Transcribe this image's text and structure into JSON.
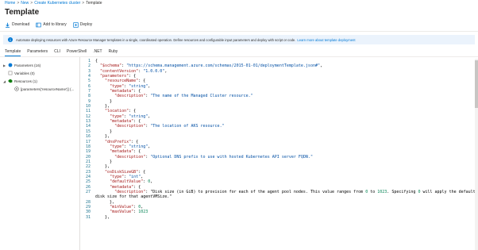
{
  "breadcrumb": {
    "items": [
      "Home",
      "New",
      "Create Kubernetes cluster"
    ],
    "current": "Template",
    "separator": ">"
  },
  "page": {
    "title": "Template"
  },
  "toolbar": {
    "download": "Download",
    "add_to_library": "Add to library",
    "deploy": "Deploy"
  },
  "info": {
    "text": "Automate deploying resources with Azure Resource Manager templates in a single, coordinated operation. Define resources and configurable input parameters and deploy with script or code.",
    "link": "Learn more about template deployment"
  },
  "tabs": [
    "Template",
    "Parameters",
    "CLI",
    "PowerShell",
    ".NET",
    "Ruby"
  ],
  "tree": [
    {
      "label": "Parameters (16)",
      "caret": "▶"
    },
    {
      "label": "Variables (0)",
      "caret": ""
    },
    {
      "label": "Resources (1)",
      "caret": "◢"
    },
    {
      "label": "[parameters('resourceName')] (...",
      "caret": ""
    }
  ],
  "code": [
    "{",
    "  \"$schema\": \"https://schema.management.azure.com/schemas/2015-01-01/deploymentTemplate.json#\",",
    "  \"contentVersion\": \"1.0.0.0\",",
    "  \"parameters\": {",
    "    \"resourceName\": {",
    "      \"type\": \"string\",",
    "      \"metadata\": {",
    "        \"description\": \"The name of the Managed Cluster resource.\"",
    "      }",
    "    },",
    "    \"location\": {",
    "      \"type\": \"string\",",
    "      \"metadata\": {",
    "        \"description\": \"The location of AKS resource.\"",
    "      }",
    "    },",
    "    \"dnsPrefix\": {",
    "      \"type\": \"string\",",
    "      \"metadata\": {",
    "        \"description\": \"Optional DNS prefix to use with hosted Kubernetes API server FQDN.\"",
    "      }",
    "    },",
    "    \"osDiskSizeGB\": {",
    "      \"type\": \"int\",",
    "      \"defaultValue\": 0,",
    "      \"metadata\": {",
    "        \"description\": \"Disk size (in GiB) to provision for each of the agent pool nodes. This value ranges from 0 to 1023. Specifying 0 will apply the default",
    "disk size for that agentVMSize.\"",
    "      },",
    "      \"minValue\": 0,",
    "      \"maxValue\": 1023",
    "    },"
  ],
  "line_numbers": [
    "1",
    "2",
    "3",
    "4",
    "5",
    "6",
    "7",
    "8",
    "9",
    "10",
    "11",
    "12",
    "13",
    "14",
    "15",
    "16",
    "17",
    "18",
    "19",
    "20",
    "21",
    "22",
    "23",
    "24",
    "25",
    "26",
    "27",
    "",
    "28",
    "29",
    "30",
    "31"
  ],
  "colors": {
    "accent": "#0078d4",
    "info_bg": "#ebf3fc",
    "string": "#0451a5",
    "key": "#a31515",
    "number": "#098658",
    "line_number": "#237893"
  }
}
